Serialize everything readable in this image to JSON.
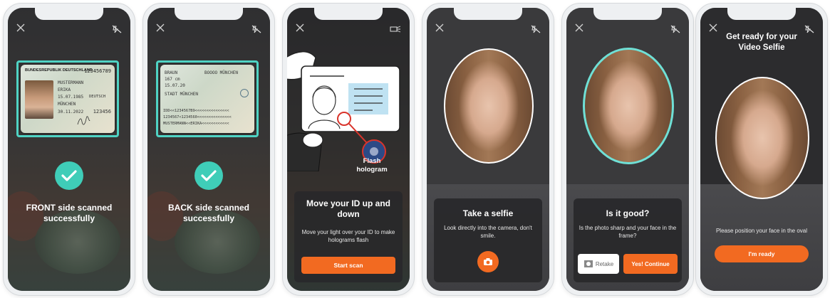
{
  "screens": {
    "front": {
      "card_header": "BUNDESREPUBLIK DEUTSCHLAND",
      "card_number": "123456789",
      "card_name": "MUSTERMANN",
      "card_given": "ERIKA",
      "card_dob": "15.07.1985",
      "card_nat": "DEUTSCH",
      "card_place": "MÜNCHEN",
      "card_expiry": "30.11.2022",
      "card_code": "123456",
      "caption": "FRONT side scanned successfully"
    },
    "back": {
      "card_l1": "BRAUN",
      "card_l2": "BOOOO MÜNCHEN",
      "card_l3": "167 cm",
      "card_l4": "15.07.20",
      "card_l5": "STADT MÜNCHEN",
      "mrz1": "IDD<<1234567B9<<<<<<<<<<<<<<<",
      "mrz2": "1234567<1234560<<<<<<<<<<<<<<<",
      "mrz3": "MUSTERMANN<<ERIKA<<<<<<<<<<<<",
      "caption": "BACK side scanned successfully"
    },
    "hologram": {
      "label": "Flash hologram",
      "title": "Move your ID up and down",
      "subtitle": "Move your light over your ID to make holograms flash",
      "button": "Start scan"
    },
    "selfie": {
      "title": "Take a selfie",
      "subtitle": "Look directly into the camera, don't smile."
    },
    "review": {
      "title": "Is it good?",
      "subtitle": "Is the photo sharp and your face in the frame?",
      "retake": "Retake",
      "continue": "Yes! Continue"
    },
    "video": {
      "title": "Get ready for your Video Selfie",
      "instruction": "Please position your face in the oval",
      "button": "I'm ready"
    }
  },
  "colors": {
    "accent": "#f26a21",
    "success": "#3fcdb8",
    "frame": "#4fd3c4"
  },
  "icons": [
    "close-icon",
    "flash-off-icon",
    "checkmark-icon",
    "camera-icon",
    "retake-icon"
  ]
}
